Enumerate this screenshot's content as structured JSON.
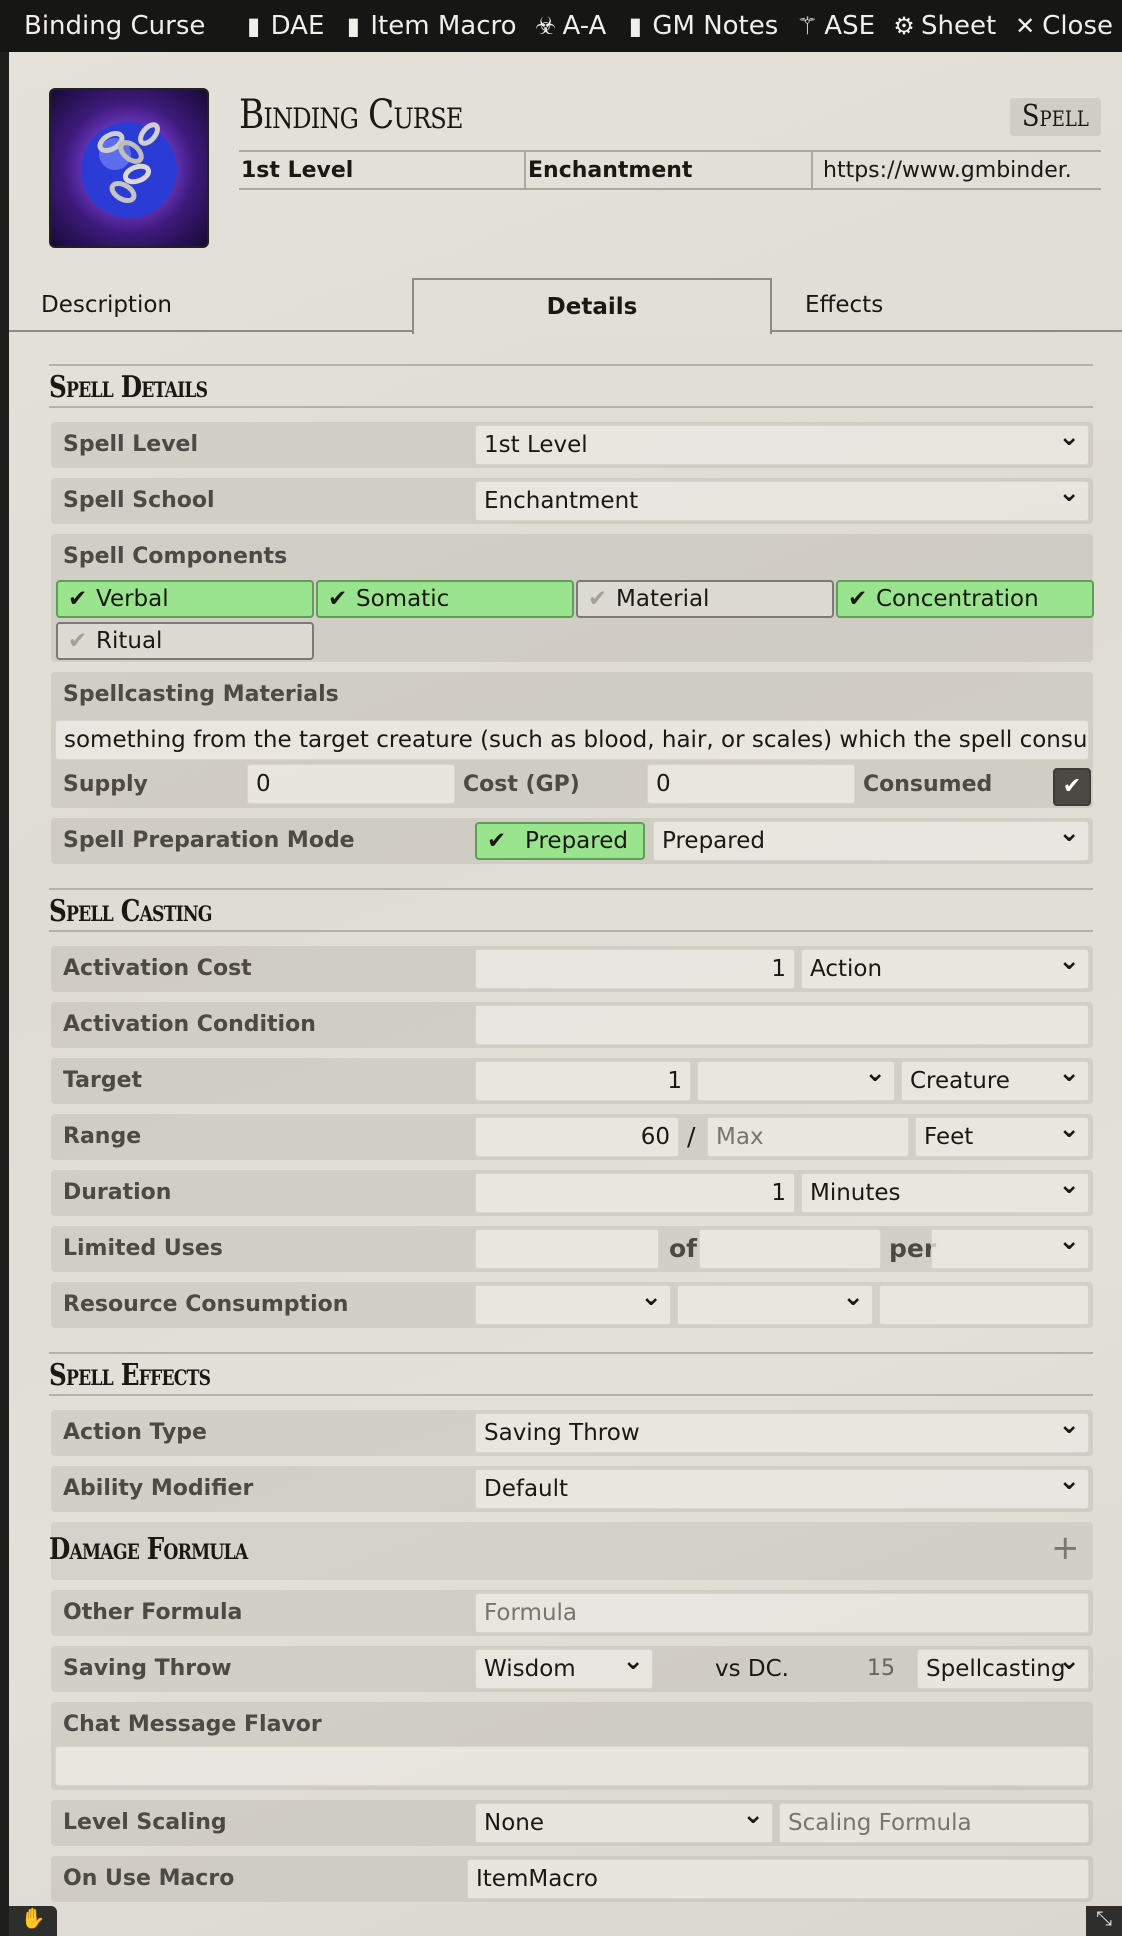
{
  "window": {
    "title": "Binding Curse",
    "header_buttons": [
      {
        "label": "DAE",
        "icon": "clipboard-icon",
        "glyph": "▮"
      },
      {
        "label": "Item Macro",
        "icon": "clipboard-icon",
        "glyph": "▮"
      },
      {
        "label": "A-A",
        "icon": "biohazard-icon",
        "glyph": "☣"
      },
      {
        "label": "GM Notes",
        "icon": "clipboard-icon",
        "glyph": "▮"
      },
      {
        "label": "ASE",
        "icon": "magic-wand-icon",
        "glyph": "⚚"
      },
      {
        "label": "Sheet",
        "icon": "gear-icon",
        "glyph": "⚙"
      },
      {
        "label": "Close",
        "icon": "close-icon",
        "glyph": "✕"
      }
    ]
  },
  "item": {
    "name": "Binding Curse",
    "type": "Spell",
    "level": "1st Level",
    "school": "Enchantment",
    "source": "https://www.gmbinder."
  },
  "tabs": [
    "Description",
    "Details",
    "Effects"
  ],
  "active_tab": "Details",
  "sections": {
    "spell_details": "Spell Details",
    "spell_casting": "Spell Casting",
    "spell_effects": "Spell Effects",
    "damage_formula": "Damage Formula"
  },
  "details": {
    "spell_level_label": "Spell Level",
    "spell_level_value": "1st Level",
    "spell_school_label": "Spell School",
    "spell_school_value": "Enchantment",
    "components_label": "Spell Components",
    "components": [
      {
        "label": "Verbal",
        "checked": true
      },
      {
        "label": "Somatic",
        "checked": true
      },
      {
        "label": "Material",
        "checked": false
      },
      {
        "label": "Concentration",
        "checked": true
      },
      {
        "label": "Ritual",
        "checked": false
      }
    ],
    "materials_label": "Spellcasting Materials",
    "materials_value": "something from the target creature (such as blood, hair, or scales) which the spell consumes",
    "supply_label": "Supply",
    "supply_value": "0",
    "cost_label": "Cost (GP)",
    "cost_value": "0",
    "consumed_label": "Consumed",
    "consumed_checked": true,
    "prep_label": "Spell Preparation Mode",
    "prep_toggle": "Prepared",
    "prep_value": "Prepared"
  },
  "casting": {
    "activation_cost_label": "Activation Cost",
    "activation_cost_value": "1",
    "activation_type": "Action",
    "activation_condition_label": "Activation Condition",
    "activation_condition_value": "",
    "target_label": "Target",
    "target_value": "1",
    "target_units": "",
    "target_type": "Creature",
    "range_label": "Range",
    "range_value": "60",
    "range_sep": "/",
    "range_max_placeholder": "Max",
    "range_units": "Feet",
    "duration_label": "Duration",
    "duration_value": "1",
    "duration_units": "Minutes",
    "uses_label": "Limited Uses",
    "uses_of": "of",
    "uses_per": "per",
    "resource_label": "Resource Consumption"
  },
  "effects": {
    "action_type_label": "Action Type",
    "action_type_value": "Saving Throw",
    "ability_label": "Ability Modifier",
    "ability_value": "Default",
    "other_formula_label": "Other Formula",
    "other_formula_placeholder": "Formula",
    "save_label": "Saving Throw",
    "save_ability": "Wisdom",
    "save_vs": "vs DC.",
    "save_dc": "15",
    "save_scaling": "Spellcasting",
    "flavor_label": "Chat Message Flavor",
    "flavor_value": "",
    "scaling_label": "Level Scaling",
    "scaling_value": "None",
    "scaling_formula_placeholder": "Scaling Formula",
    "macro_label": "On Use Macro",
    "macro_value": "ItemMacro",
    "add_damage": "+"
  },
  "colors": {
    "component_on": "#9be48f",
    "titlebar": "#161614",
    "background": "#e2e0d8"
  }
}
